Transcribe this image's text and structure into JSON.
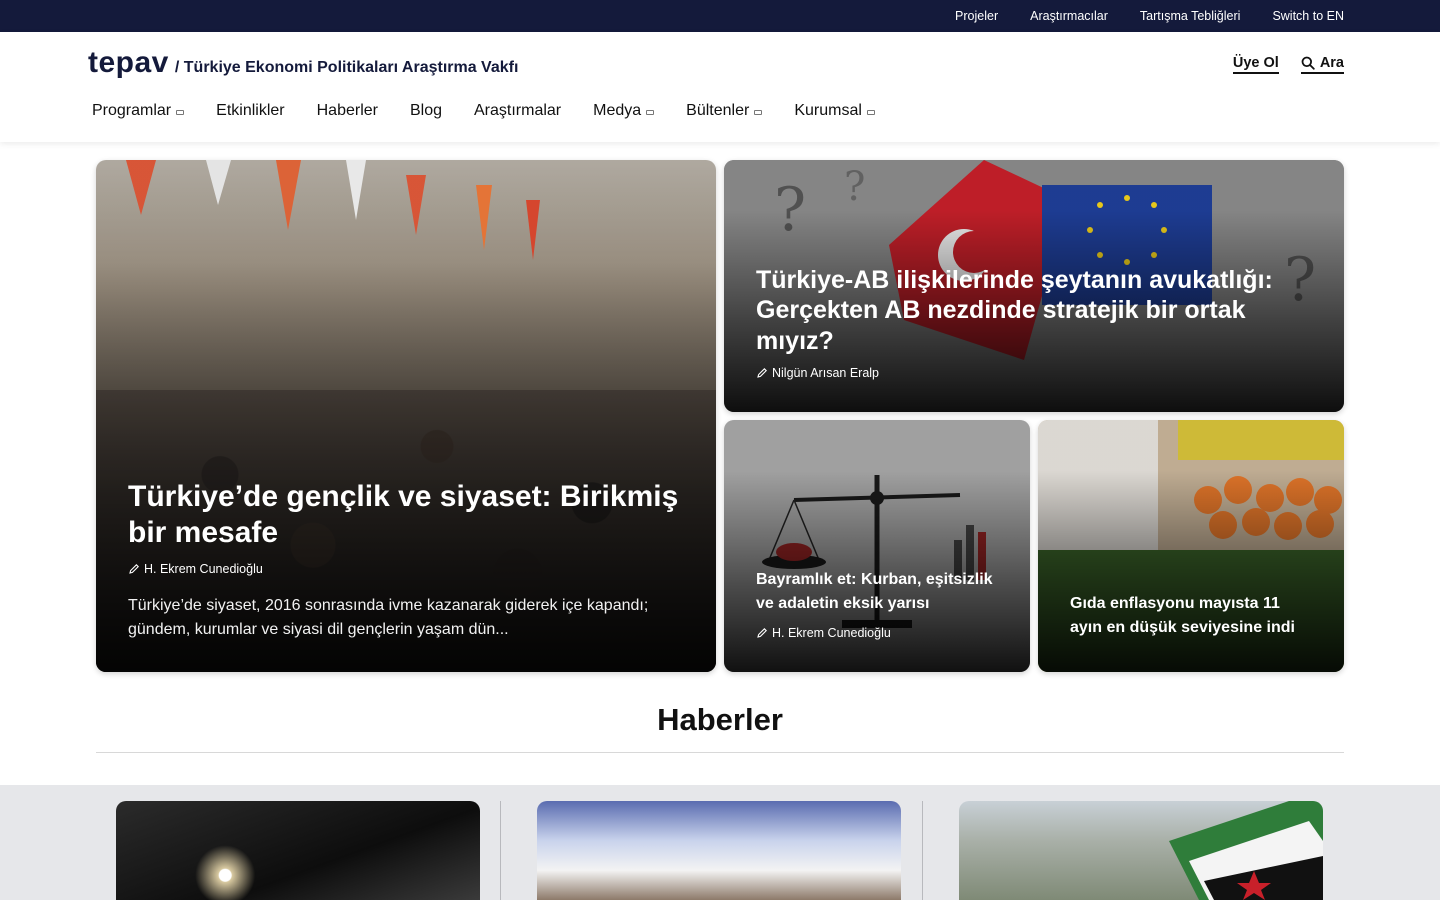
{
  "topbar": {
    "links": [
      "Projeler",
      "Araştırmacılar",
      "Tartışma Tebliğleri",
      "Switch to EN"
    ]
  },
  "header": {
    "logo": "tepav",
    "tagline": "/ Türkiye Ekonomi Politikaları Araştırma Vakfı",
    "signup_label": "Üye Ol",
    "search_label": "Ara"
  },
  "nav": {
    "items": [
      {
        "label": "Programlar",
        "has_dropdown": true
      },
      {
        "label": "Etkinlikler",
        "has_dropdown": false
      },
      {
        "label": "Haberler",
        "has_dropdown": false
      },
      {
        "label": "Blog",
        "has_dropdown": false
      },
      {
        "label": "Araştırmalar",
        "has_dropdown": false
      },
      {
        "label": "Medya",
        "has_dropdown": true
      },
      {
        "label": "Bültenler",
        "has_dropdown": true
      },
      {
        "label": "Kurumsal",
        "has_dropdown": true
      }
    ]
  },
  "hero": {
    "main": {
      "title": "Türkiye’de gençlik ve siyaset: Birikmiş bir mesafe",
      "author": "H. Ekrem Cunedioğlu",
      "excerpt": "Türkiye’de siyaset, 2016 sonrasında ivme kazanarak giderek içe kapandı; gündem, kurumlar ve siyasi dil gençlerin yaşam dün..."
    },
    "ab": {
      "title": "Türkiye-AB ilişkilerinde şeytanın avukatlığı: Gerçekten AB nezdinde stratejik bir ortak mıyız?",
      "author": "Nilgün Arısan Eralp"
    },
    "et": {
      "title": "Bayramlık et: Kurban, eşitsizlik ve adaletin eksik yarısı",
      "author": "H. Ekrem Cunedioğlu"
    },
    "gida": {
      "title": "Gıda enflasyonu mayısta 11 ayın en düşük seviyesine indi"
    }
  },
  "section": {
    "title": "Haberler"
  },
  "colors": {
    "topbar_bg": "#141a3b",
    "brand": "#141a3b",
    "news_strip_bg": "#e6e7ea"
  }
}
